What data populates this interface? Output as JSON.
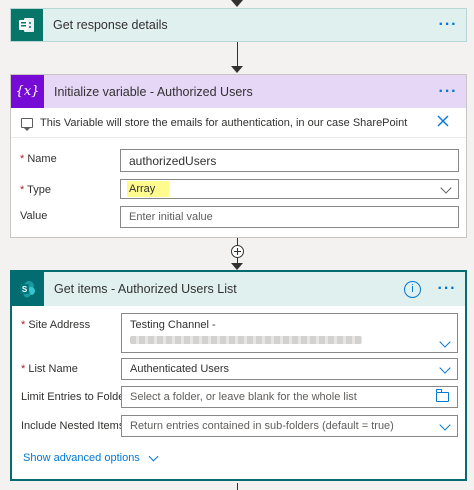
{
  "flow": {
    "step1": {
      "title": "Get response details",
      "icon": "forms-icon",
      "color": "#077568",
      "more_label": "···"
    },
    "step2": {
      "title": "Initialize variable - Authorized Users",
      "icon": "variable-icon",
      "color": "#770bd6",
      "header_bg": "#e7d7f7",
      "more_label": "···",
      "comment": "This Variable will store the emails for authentication, in our case SharePoint",
      "fields": {
        "name": {
          "label": "Name",
          "required": "*",
          "value": "authorizedUsers"
        },
        "type": {
          "label": "Type",
          "required": "*",
          "value": "Array"
        },
        "value": {
          "label": "Value",
          "placeholder": "Enter initial value"
        }
      }
    },
    "step3": {
      "title": "Get items - Authorized Users List",
      "icon": "sharepoint-icon",
      "color": "#036c70",
      "header_bg": "#e0f0ef",
      "more_label": "···",
      "info_label": "i",
      "fields": {
        "site_address": {
          "label": "Site Address",
          "required": "*",
          "value": "Testing Channel -"
        },
        "list_name": {
          "label": "List Name",
          "required": "*",
          "value": "Authenticated Users"
        },
        "limit_folder": {
          "label": "Limit Entries to Folder",
          "placeholder": "Select a folder, or leave blank for the whole list"
        },
        "nested_items": {
          "label": "Include Nested Items",
          "placeholder": "Return entries contained in sub-folders (default = true)"
        }
      },
      "advanced_label": "Show advanced options"
    },
    "colors": {
      "accent": "#0078d4",
      "required": "#a4262c",
      "highlight": "#fffb8f"
    }
  }
}
